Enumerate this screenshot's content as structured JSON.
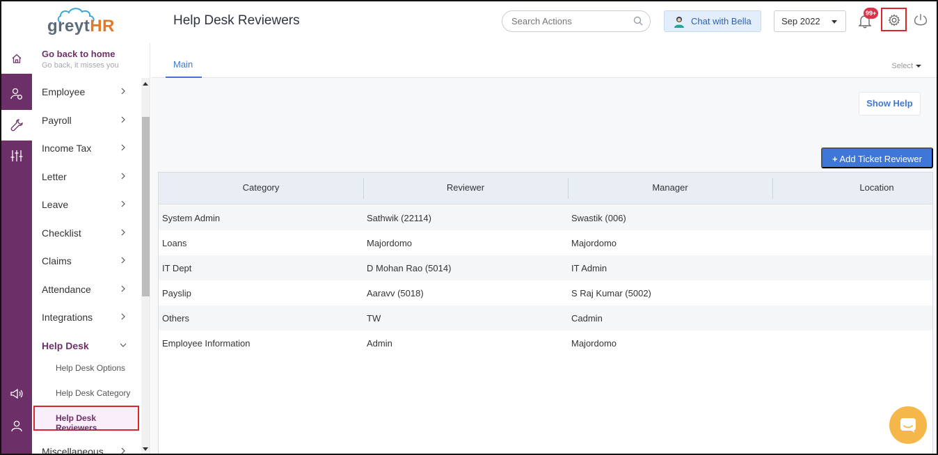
{
  "app": {
    "logo_grey": "greyt",
    "logo_hr": "HR",
    "page_title": "Help Desk Reviewers"
  },
  "header": {
    "search_placeholder": "Search Actions",
    "chat_label": "Chat with Bella",
    "period": "Sep 2022",
    "notification_count": "99+"
  },
  "sidebar": {
    "go_back_title": "Go back to home",
    "go_back_sub": "Go back, it misses you",
    "items": [
      {
        "label": "Employee"
      },
      {
        "label": "Payroll"
      },
      {
        "label": "Income Tax"
      },
      {
        "label": "Letter"
      },
      {
        "label": "Leave"
      },
      {
        "label": "Checklist"
      },
      {
        "label": "Claims"
      },
      {
        "label": "Attendance"
      },
      {
        "label": "Integrations"
      },
      {
        "label": "Help Desk"
      },
      {
        "label": "Miscellaneous"
      }
    ],
    "sub_items": [
      {
        "label": "Help Desk Options"
      },
      {
        "label": "Help Desk Category"
      },
      {
        "label": "Help Desk Reviewers"
      }
    ]
  },
  "main": {
    "tab_label": "Main",
    "select_label": "Select",
    "show_help_label": "Show Help",
    "add_label": "Add Ticket Reviewer",
    "columns": [
      "Category",
      "Reviewer",
      "Manager",
      "Location"
    ],
    "rows": [
      {
        "category": "System Admin",
        "reviewer": "Sathwik (22114)",
        "manager": "Swastik (006)",
        "location": ""
      },
      {
        "category": "Loans",
        "reviewer": "Majordomo",
        "manager": "Majordomo",
        "location": ""
      },
      {
        "category": "IT Dept",
        "reviewer": "D Mohan Rao (5014)",
        "manager": "IT Admin",
        "location": ""
      },
      {
        "category": "Payslip",
        "reviewer": "Aaravv (5018)",
        "manager": "S Raj Kumar (5002)",
        "location": ""
      },
      {
        "category": "Others",
        "reviewer": "TW",
        "manager": "Cadmin",
        "location": ""
      },
      {
        "category": "Employee Information",
        "reviewer": "Admin",
        "manager": "Majordomo",
        "location": ""
      }
    ]
  },
  "colors": {
    "brand_purple": "#6d2f67",
    "accent_blue": "#3f77d8",
    "logo_orange": "#e07a2a",
    "highlight_red": "#d9262c",
    "chat_widget": "#f5b64a"
  },
  "icons": {
    "rail": [
      "home-icon",
      "user-settings-icon",
      "wrench-icon",
      "sliders-icon",
      "megaphone-icon",
      "user-icon"
    ],
    "header": [
      "search-icon",
      "bell-icon",
      "gear-icon",
      "power-icon"
    ]
  }
}
